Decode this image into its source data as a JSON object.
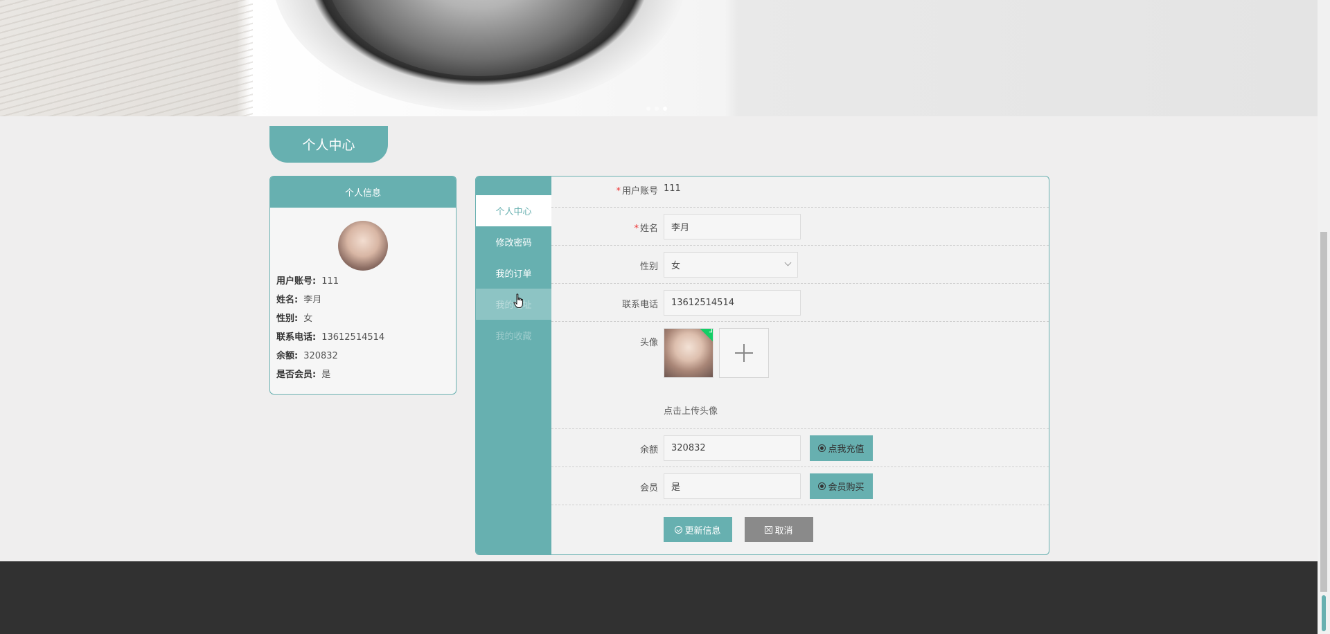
{
  "hero": {
    "carousel_dots": 3,
    "active_dot": 3
  },
  "page": {
    "title": "个人中心"
  },
  "info_card": {
    "title": "个人信息",
    "rows": [
      {
        "label": "用户账号:",
        "value": "111"
      },
      {
        "label": "姓名:",
        "value": "李月"
      },
      {
        "label": "性别:",
        "value": "女"
      },
      {
        "label": "联系电话:",
        "value": "13612514514"
      },
      {
        "label": "余额:",
        "value": "320832"
      },
      {
        "label": "是否会员:",
        "value": "是"
      }
    ]
  },
  "side_nav": {
    "items": [
      {
        "label": "个人中心"
      },
      {
        "label": "修改密码"
      },
      {
        "label": "我的订单"
      },
      {
        "label": "我的地址"
      },
      {
        "label": "我的收藏"
      }
    ]
  },
  "form": {
    "account": {
      "label": "用户账号",
      "value": "111"
    },
    "name": {
      "label": "姓名",
      "value": "李月"
    },
    "gender": {
      "label": "性别",
      "value": "女"
    },
    "phone": {
      "label": "联系电话",
      "value": "13612514514"
    },
    "avatar": {
      "label": "头像",
      "hint": "点击上传头像"
    },
    "balance": {
      "label": "余额",
      "value": "320832",
      "button": "点我充值"
    },
    "member": {
      "label": "会员",
      "value": "是",
      "button": "会员购买"
    },
    "update_button": "更新信息",
    "cancel_button": "取消"
  },
  "colors": {
    "accent": "#67b0b0",
    "footer": "#313131",
    "required": "#ee3333",
    "success": "#13ce66"
  }
}
